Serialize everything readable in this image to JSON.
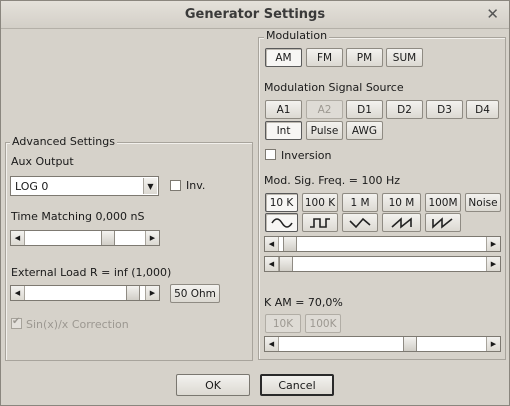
{
  "window": {
    "title": "Generator Settings",
    "close_glyph": "✕"
  },
  "modulation": {
    "group_label": "Modulation",
    "types": [
      "AM",
      "FM",
      "PM",
      "SUM"
    ],
    "source_label": "Modulation Signal Source",
    "sources_row1": [
      "A1",
      "A2",
      "D1",
      "D2",
      "D3",
      "D4"
    ],
    "sources_row2": [
      "Int",
      "Pulse",
      "AWG"
    ],
    "inversion_label": "Inversion",
    "freq_label": "Mod. Sig. Freq. = 100 Hz",
    "freq_buttons": [
      "10 K",
      "100 K",
      "1 M",
      "10 M",
      "100M",
      "Noise"
    ],
    "waveform_icons": [
      "sine-icon",
      "square-icon",
      "triangle-icon",
      "sawtooth-icon",
      "reverse-sawtooth-icon"
    ],
    "k_label": "K AM = 70,0%",
    "k_buttons": [
      "10K",
      "100K"
    ],
    "freq_slider_value": 0.02,
    "freq_slider2_value": 0.0,
    "k_slider_value": 0.64
  },
  "advanced": {
    "group_label": "Advanced Settings",
    "aux_label": "Aux Output",
    "aux_value": "LOG 0",
    "inv_label": "Inv.",
    "time_label": "Time Matching 0,000 nS",
    "time_slider_value": 0.72,
    "load_label": "External Load R = inf  (1,000)",
    "load_slider_value": 0.95,
    "load_button": "50 Ohm",
    "sinx_label": "Sin(x)/x Correction"
  },
  "footer": {
    "ok": "OK",
    "cancel": "Cancel"
  }
}
